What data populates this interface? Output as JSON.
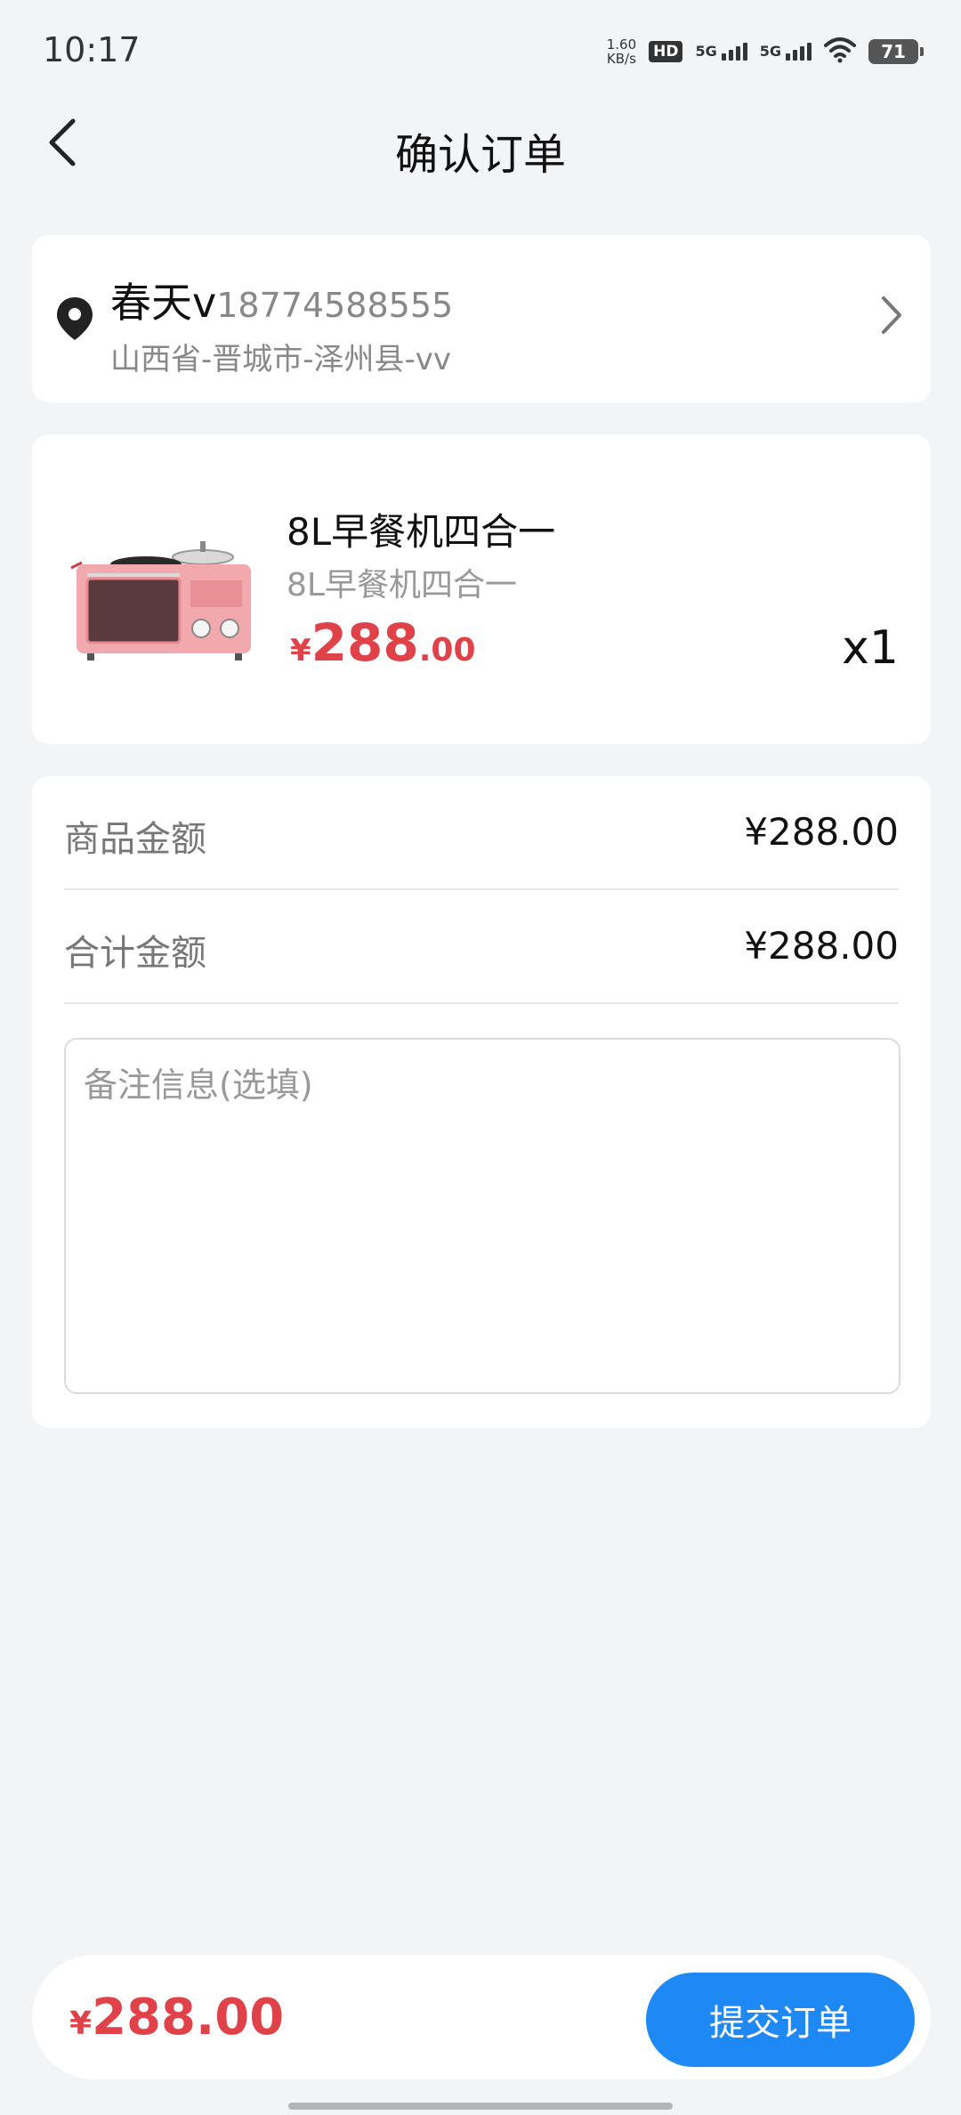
{
  "status_bar": {
    "time": "10:17",
    "net_speed_value": "1.60",
    "net_speed_unit": "KB/s",
    "hd_label": "HD",
    "sim1_label": "5G",
    "sim2_label": "5G",
    "battery": "71"
  },
  "header": {
    "title": "确认订单",
    "back_icon": "chevron-left-icon"
  },
  "address": {
    "name": "春天v",
    "phone": "18774588555",
    "detail": "山西省-晋城市-泽州县-vv",
    "icon": "location-pin-icon"
  },
  "product": {
    "name": "8L早餐机四合一",
    "spec": "8L早餐机四合一",
    "price_symbol": "¥",
    "price_int": "288",
    "price_dec": ".00",
    "quantity": "x1"
  },
  "summary": {
    "goods_label": "商品金额",
    "goods_value": "¥288.00",
    "total_label": "合计金额",
    "total_value": "¥288.00",
    "remark_placeholder": "备注信息(选填)"
  },
  "bottom": {
    "currency": "¥",
    "total": "288.00",
    "submit_label": "提交订单"
  },
  "colors": {
    "accent": "#1e88f5",
    "price": "#e0424a",
    "background": "#f3f4f6"
  }
}
